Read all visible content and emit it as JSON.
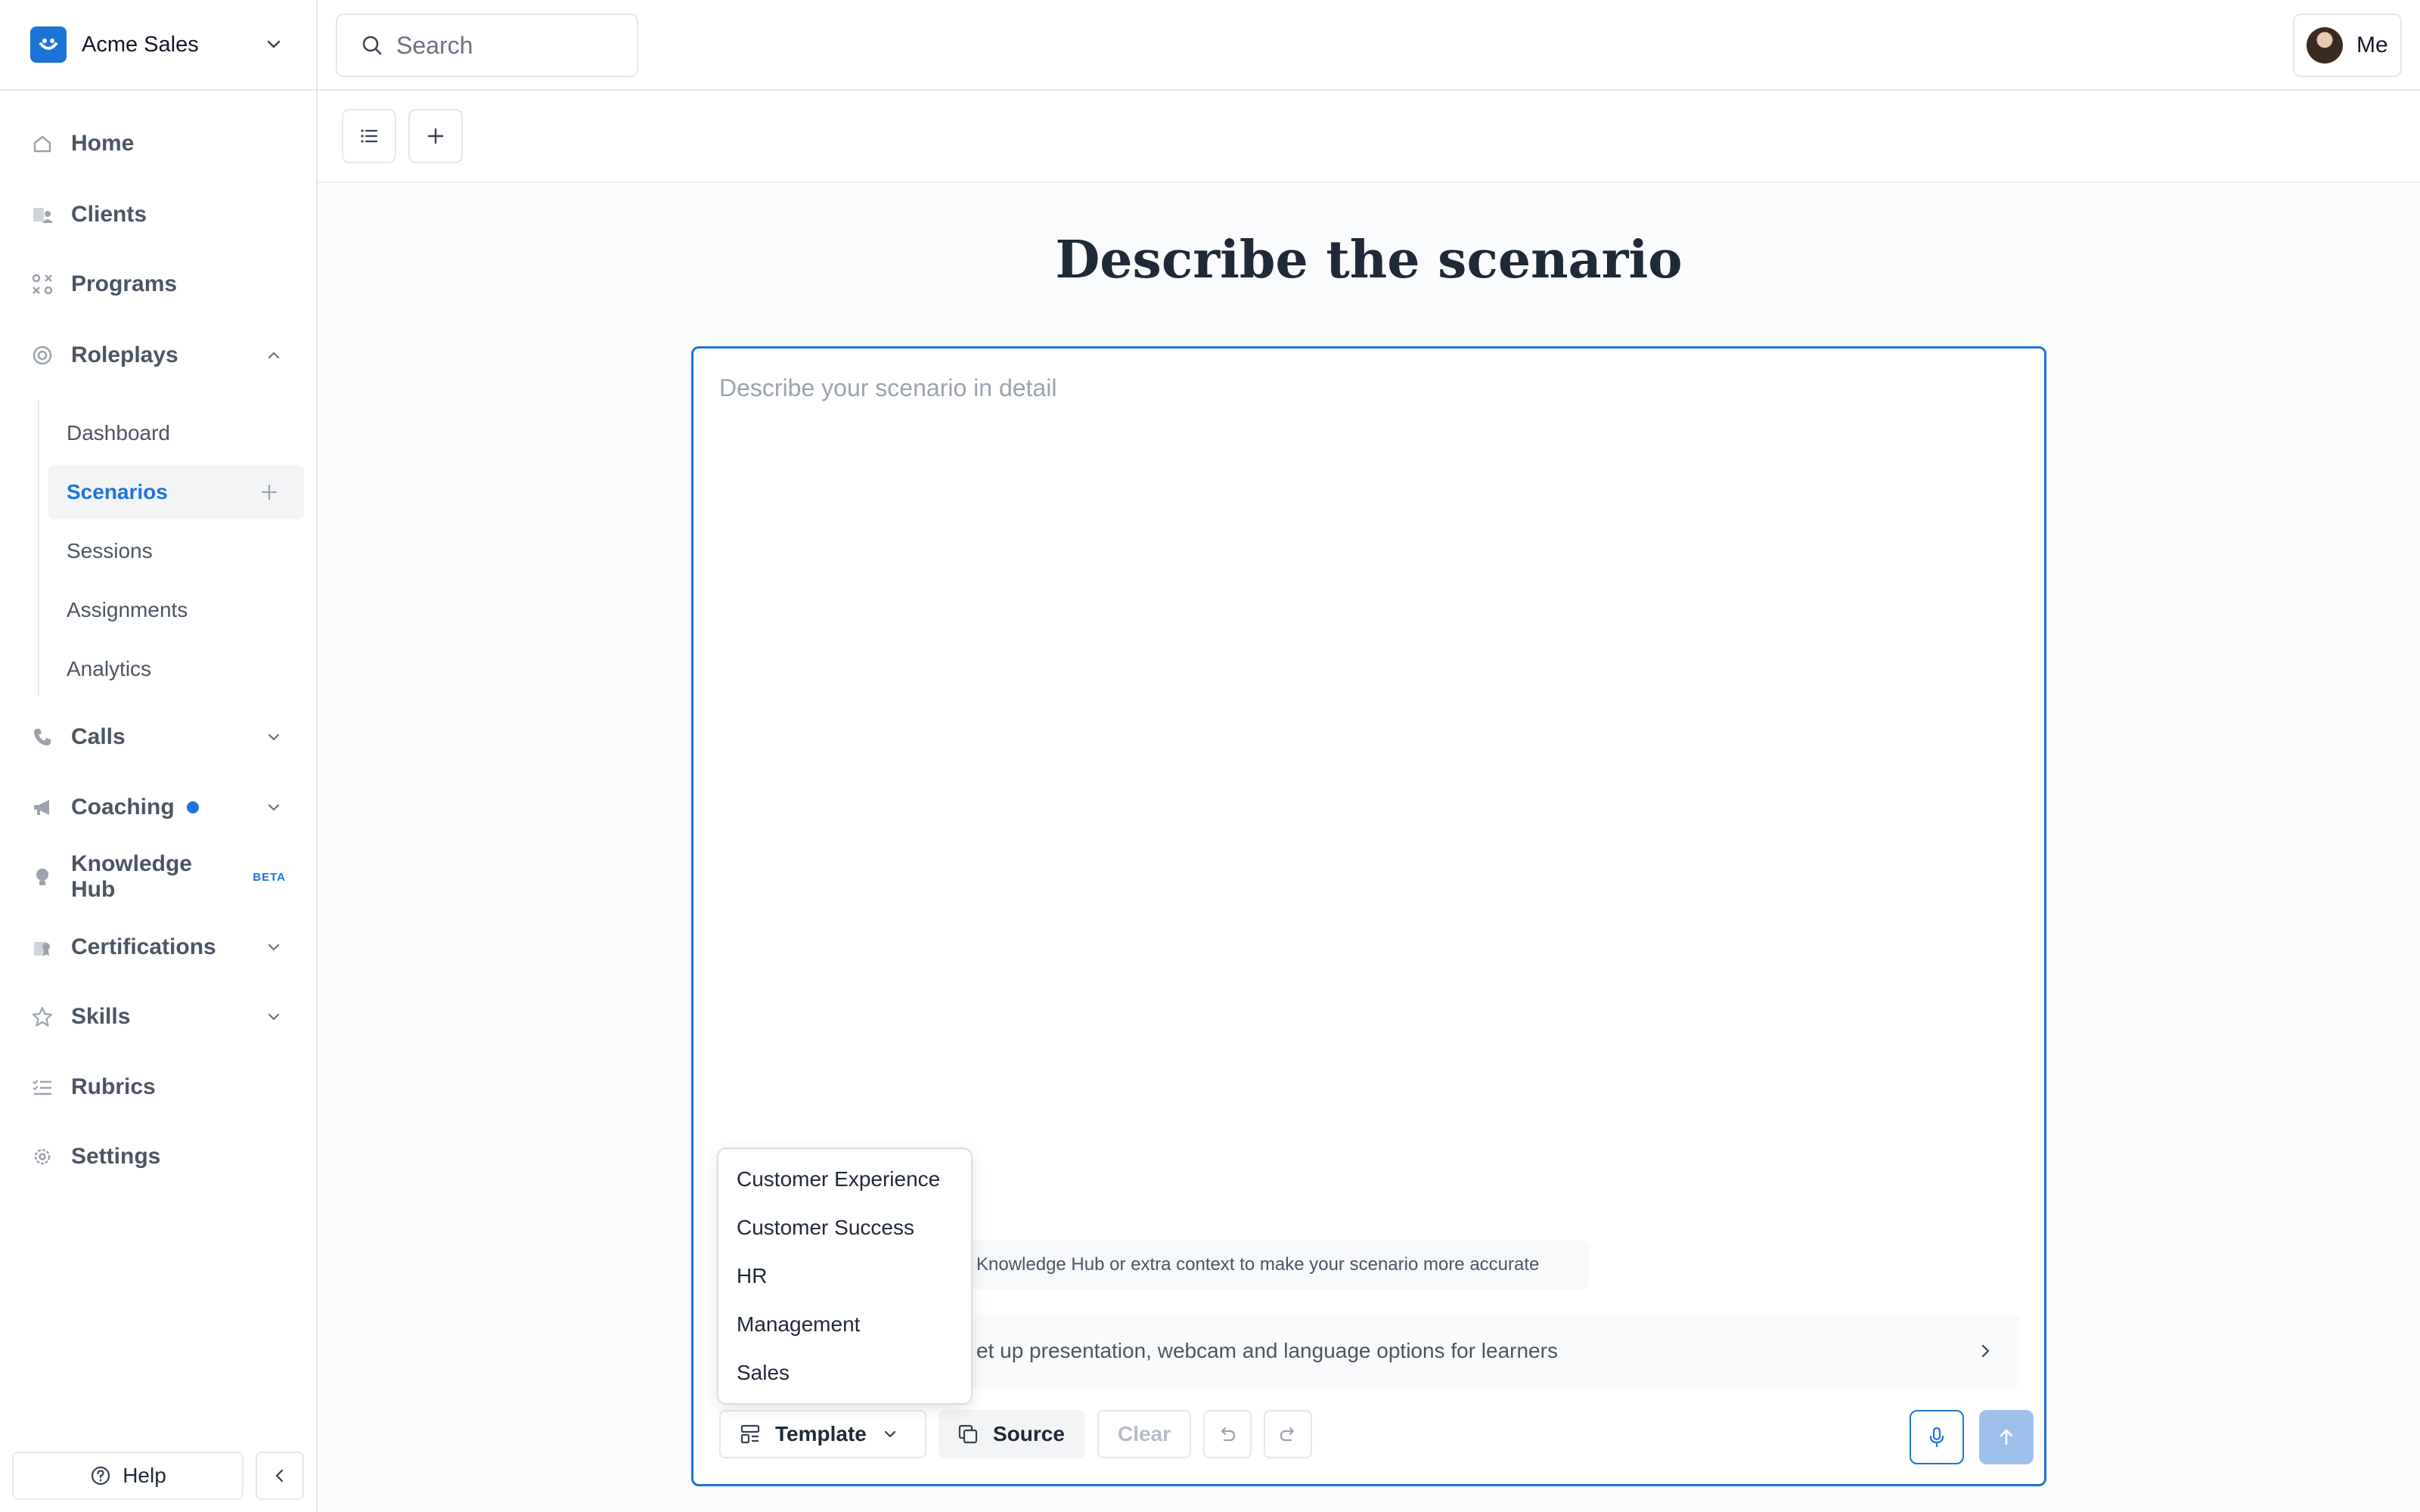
{
  "workspace": {
    "name": "Acme Sales"
  },
  "search": {
    "placeholder": "Search"
  },
  "user": {
    "label": "Me"
  },
  "sidebar": {
    "items": [
      {
        "label": "Home",
        "icon": "home-icon"
      },
      {
        "label": "Clients",
        "icon": "clients-icon"
      },
      {
        "label": "Programs",
        "icon": "programs-icon"
      },
      {
        "label": "Roleplays",
        "icon": "target-icon",
        "expanded": true
      },
      {
        "label": "Calls",
        "icon": "phone-icon"
      },
      {
        "label": "Coaching",
        "icon": "megaphone-icon",
        "has_dot": true
      },
      {
        "label": "Knowledge Hub",
        "icon": "lightbulb-icon",
        "badge": "BETA"
      },
      {
        "label": "Certifications",
        "icon": "certificate-icon"
      },
      {
        "label": "Skills",
        "icon": "star-icon"
      },
      {
        "label": "Rubrics",
        "icon": "checklist-icon"
      },
      {
        "label": "Settings",
        "icon": "gear-icon"
      }
    ],
    "roleplays_sub": [
      {
        "label": "Dashboard"
      },
      {
        "label": "Scenarios",
        "active": true
      },
      {
        "label": "Sessions"
      },
      {
        "label": "Assignments"
      },
      {
        "label": "Analytics"
      }
    ],
    "help_label": "Help"
  },
  "main": {
    "title": "Describe the scenario",
    "editor_placeholder": "Describe your scenario in detail",
    "hint_text": "Knowledge Hub or extra context to make your scenario more accurate",
    "settings_text": "et up presentation, webcam and language options for learners",
    "buttons": {
      "template": "Template",
      "source": "Source",
      "clear": "Clear"
    }
  },
  "template_dropdown": {
    "options": [
      "Customer Experience",
      "Customer Success",
      "HR",
      "Management",
      "Sales"
    ]
  },
  "colors": {
    "accent": "#1d74d8",
    "border": "#e5e7eb"
  }
}
